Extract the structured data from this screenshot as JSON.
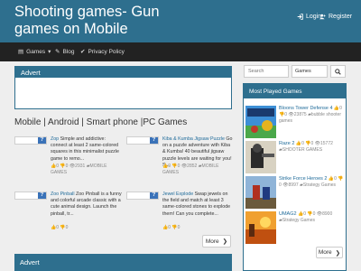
{
  "header": {
    "site_title": "Shooting games- Gun games on Mobile",
    "login_label": "Login",
    "register_label": "Register"
  },
  "nav": {
    "games_label": "Games",
    "blog_label": "Blog",
    "privacy_label": "Privacy Policy"
  },
  "main": {
    "advert_label": "Advert",
    "section_heading": "Mobile | Android | Smart phone |PC Games",
    "more_label": "More",
    "advert2_label": "Advert",
    "games": [
      {
        "title": "Zop",
        "desc": "Simple and addictive: connect at least 2 same-colored squares in this minimalist puzzle game to remo...",
        "likes": "0",
        "dislikes": "0",
        "views": "2931",
        "category": "MOBILE GAMES"
      },
      {
        "title": "Kiba & Kumba Jigsaw Puzzle",
        "desc": "Go on a puzzle adventure with Kiba & Kumba! 40 beautiful jigsaw puzzle levels are waiting for you! S...",
        "likes": "0",
        "dislikes": "0",
        "views": "2852",
        "category": "MOBILE GAMES"
      },
      {
        "title": "Zoo Pinball",
        "desc": "Zoo Pinball is a funny and colorful arcade classic with a cute animal design. Launch the pinball, tr...",
        "likes": "0",
        "dislikes": "0",
        "views": "",
        "category": ""
      },
      {
        "title": "Jewel Explode",
        "desc": "Swap jewels on the field and match at least 3 same-colored stones to explode them! Can you complete...",
        "likes": "0",
        "dislikes": "0",
        "views": "",
        "category": ""
      }
    ]
  },
  "sidebar": {
    "search_placeholder": "Search",
    "search_select": "Games",
    "most_played_label": "Most Played Games",
    "more_label": "More",
    "items": [
      {
        "title": "Bloons Tower Defense 4",
        "likes": "0",
        "dislikes": "0",
        "views": "23875",
        "category": "bubble shooter games"
      },
      {
        "title": "Raze 2",
        "likes": "0",
        "dislikes": "0",
        "views": "15772",
        "category": "SHOOTER GAMES"
      },
      {
        "title": "Strike Force Heroes 2",
        "likes": "0",
        "dislikes": "0",
        "views": "8997",
        "category": "Strategy Games"
      },
      {
        "title": "UMAG2",
        "likes": "0",
        "dislikes": "0",
        "views": "8900",
        "category": "Strategy Games"
      }
    ]
  },
  "colors": {
    "header": "#2e6f8e",
    "navbar": "#222222",
    "link": "#1f6b9a"
  }
}
